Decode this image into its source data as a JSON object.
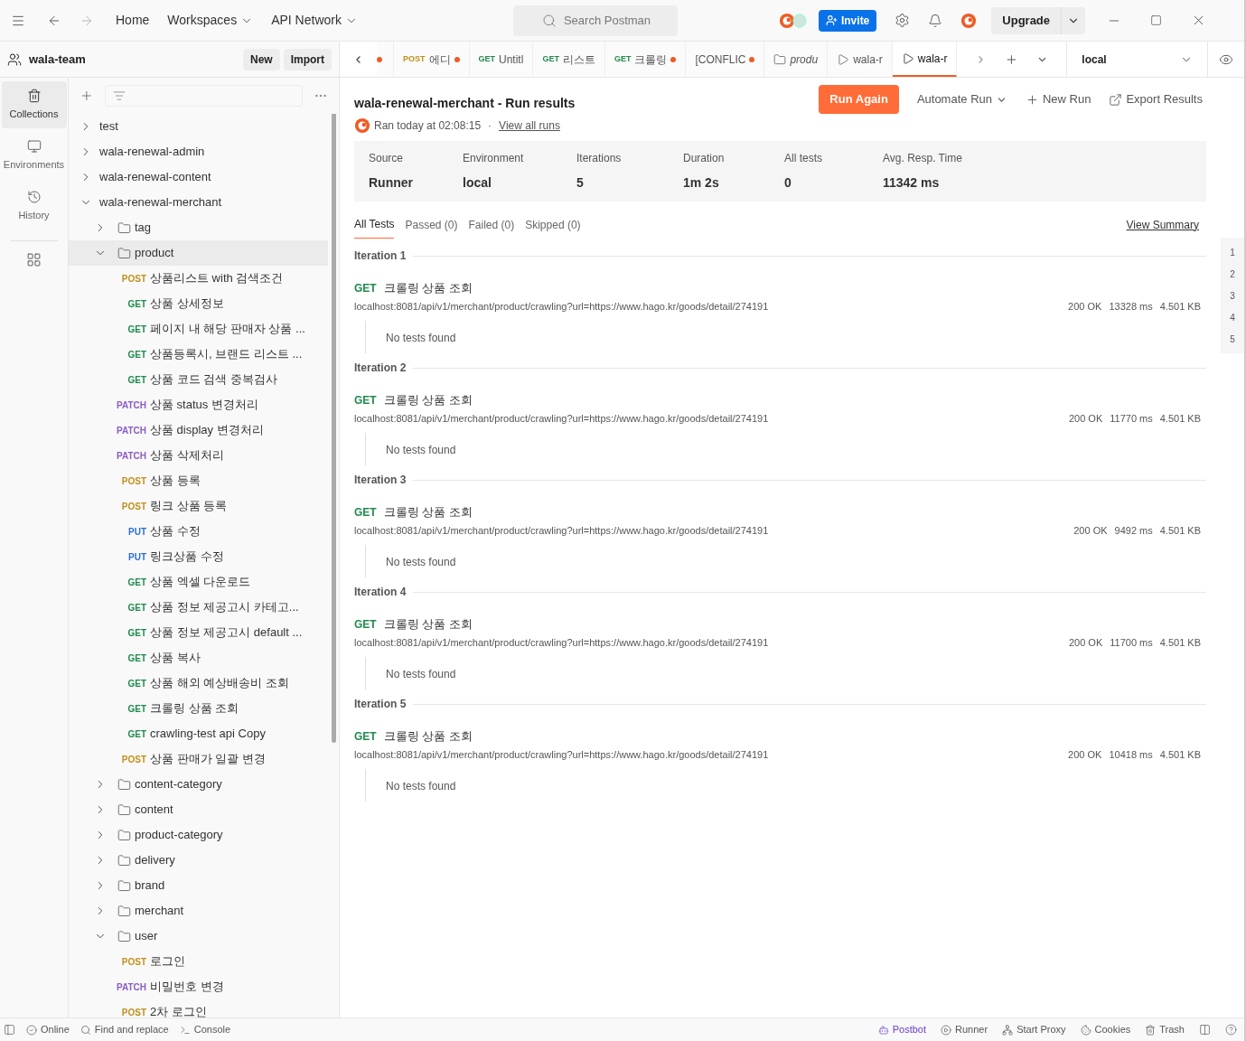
{
  "topbar": {
    "nav": [
      "Home",
      "Workspaces",
      "API Network"
    ],
    "search": {
      "placeholder": "Search Postman"
    },
    "invite": "Invite",
    "upgrade": "Upgrade"
  },
  "workspace": {
    "name": "wala-team",
    "buttons": [
      "New",
      "Import"
    ]
  },
  "rail": [
    {
      "label": "Collections",
      "selected": true
    },
    {
      "label": "Environments",
      "selected": false
    },
    {
      "label": "History",
      "selected": false
    }
  ],
  "tree": [
    {
      "label": "test",
      "expanded": false
    },
    {
      "label": "wala-renewal-admin",
      "expanded": false
    },
    {
      "label": "wala-renewal-content",
      "expanded": false
    },
    {
      "label": "wala-renewal-merchant",
      "expanded": true,
      "children": [
        {
          "label": "tag",
          "kind": "folder",
          "expanded": false,
          "selected": false
        },
        {
          "label": "product",
          "kind": "folder",
          "expanded": true,
          "selected": true,
          "children": [
            {
              "method": "POST",
              "color": "#c0901a",
              "label": "상품리스트 with 검색조건"
            },
            {
              "method": "GET",
              "color": "#1f8a4c",
              "label": "상품 상세정보"
            },
            {
              "method": "GET",
              "color": "#1f8a4c",
              "label": "페이지 내 해당 판매자 상품 ..."
            },
            {
              "method": "GET",
              "color": "#1f8a4c",
              "label": "상품등록시, 브랜드 리스트 ..."
            },
            {
              "method": "GET",
              "color": "#1f8a4c",
              "label": "상품 코드 검색 중복검사"
            },
            {
              "method": "PATCH",
              "color": "#8a5cc4",
              "label": "상품 status 변경처리"
            },
            {
              "method": "PATCH",
              "color": "#8a5cc4",
              "label": "상품 display 변경처리"
            },
            {
              "method": "PATCH",
              "color": "#8a5cc4",
              "label": "상품 삭제처리"
            },
            {
              "method": "POST",
              "color": "#c0901a",
              "label": "상품 등록"
            },
            {
              "method": "POST",
              "color": "#c0901a",
              "label": "링크 상품 등록"
            },
            {
              "method": "PUT",
              "color": "#2b6fd6",
              "label": "상품 수정"
            },
            {
              "method": "PUT",
              "color": "#2b6fd6",
              "label": "링크상품 수정"
            },
            {
              "method": "GET",
              "color": "#1f8a4c",
              "label": "상품 엑셀 다운로드"
            },
            {
              "method": "GET",
              "color": "#1f8a4c",
              "label": "상품 정보 제공고시 카테고..."
            },
            {
              "method": "GET",
              "color": "#1f8a4c",
              "label": "상품 정보 제공고시 default ..."
            },
            {
              "method": "GET",
              "color": "#1f8a4c",
              "label": "상품 복사"
            },
            {
              "method": "GET",
              "color": "#1f8a4c",
              "label": "상품 해외 예상배송비 조회"
            },
            {
              "method": "GET",
              "color": "#1f8a4c",
              "label": "크롤링 상품 조회"
            },
            {
              "method": "GET",
              "color": "#1f8a4c",
              "label": "crawling-test api Copy"
            },
            {
              "method": "POST",
              "color": "#c0901a",
              "label": "상품 판매가 일괄 변경"
            }
          ]
        },
        {
          "label": "content-category",
          "kind": "folder",
          "expanded": false,
          "selected": false
        },
        {
          "label": "content",
          "kind": "folder",
          "expanded": false,
          "selected": false
        },
        {
          "label": "product-category",
          "kind": "folder",
          "expanded": false,
          "selected": false
        },
        {
          "label": "delivery",
          "kind": "folder",
          "expanded": false,
          "selected": false
        },
        {
          "label": "brand",
          "kind": "folder",
          "expanded": false,
          "selected": false
        },
        {
          "label": "merchant",
          "kind": "folder",
          "expanded": false,
          "selected": false
        },
        {
          "label": "user",
          "kind": "folder",
          "expanded": true,
          "selected": false,
          "children": [
            {
              "method": "POST",
              "color": "#c0901a",
              "label": "로그인"
            },
            {
              "method": "PATCH",
              "color": "#8a5cc4",
              "label": "비밀번호 변경"
            },
            {
              "method": "POST",
              "color": "#c0901a",
              "label": "2차 로그인"
            }
          ]
        }
      ]
    }
  ],
  "tabs": [
    {
      "kind": "dot",
      "unsaved": true,
      "selected": false
    },
    {
      "kind": "request",
      "method": "POST",
      "color": "#c0901a",
      "label": "에디",
      "unsaved": true,
      "selected": false
    },
    {
      "kind": "request",
      "method": "GET",
      "color": "#1f8a4c",
      "label": "Untitl",
      "unsaved": false,
      "selected": false
    },
    {
      "kind": "request",
      "method": "GET",
      "color": "#1f8a4c",
      "label": "리스트",
      "unsaved": false,
      "selected": false
    },
    {
      "kind": "request",
      "method": "GET",
      "color": "#1f8a4c",
      "label": "크롤링",
      "unsaved": true,
      "selected": false
    },
    {
      "kind": "plain",
      "label": "[CONFLIC",
      "unsaved": true,
      "selected": false
    },
    {
      "kind": "folder",
      "label": "produ",
      "unsaved": false,
      "selected": false
    },
    {
      "kind": "runner",
      "label": "wala-r",
      "unsaved": false,
      "selected": false
    },
    {
      "kind": "runner",
      "label": "wala-r",
      "unsaved": false,
      "selected": true
    }
  ],
  "environment": "local",
  "run": {
    "title": "wala-renewal-merchant - Run results",
    "ran": "Ran today at 02:08:15",
    "sep": "·",
    "view_all": "View all runs",
    "run_again": "Run Again",
    "automate": "Automate Run",
    "new_run": "New Run",
    "export": "Export Results",
    "stats": [
      {
        "label": "Source",
        "value": "Runner"
      },
      {
        "label": "Environment",
        "value": "local"
      },
      {
        "label": "Iterations",
        "value": "5"
      },
      {
        "label": "Duration",
        "value": "1m 2s"
      },
      {
        "label": "All tests",
        "value": "0"
      },
      {
        "label": "Avg. Resp. Time",
        "value": "11342 ms"
      }
    ],
    "filters": [
      {
        "label": "All Tests",
        "selected": true
      },
      {
        "label": "Passed (0)",
        "selected": false
      },
      {
        "label": "Failed (0)",
        "selected": false
      },
      {
        "label": "Skipped (0)",
        "selected": false
      }
    ],
    "view_summary": "View Summary",
    "iterations": [
      {
        "title": "Iteration 1",
        "marker": "1",
        "method": "GET",
        "name": "크롤링 상품 조회",
        "url": "localhost:8081/api/v1/merchant/product/crawling?url=https://www.hago.kr/goods/detail/274191",
        "status": "200 OK",
        "time": "13328 ms",
        "size": "4.501 KB",
        "tests": "No tests found"
      },
      {
        "title": "Iteration 2",
        "marker": "2",
        "method": "GET",
        "name": "크롤링 상품 조회",
        "url": "localhost:8081/api/v1/merchant/product/crawling?url=https://www.hago.kr/goods/detail/274191",
        "status": "200 OK",
        "time": "11770 ms",
        "size": "4.501 KB",
        "tests": "No tests found"
      },
      {
        "title": "Iteration 3",
        "marker": "3",
        "method": "GET",
        "name": "크롤링 상품 조회",
        "url": "localhost:8081/api/v1/merchant/product/crawling?url=https://www.hago.kr/goods/detail/274191",
        "status": "200 OK",
        "time": "9492 ms",
        "size": "4.501 KB",
        "tests": "No tests found"
      },
      {
        "title": "Iteration 4",
        "marker": "4",
        "method": "GET",
        "name": "크롤링 상품 조회",
        "url": "localhost:8081/api/v1/merchant/product/crawling?url=https://www.hago.kr/goods/detail/274191",
        "status": "200 OK",
        "time": "11700 ms",
        "size": "4.501 KB",
        "tests": "No tests found"
      },
      {
        "title": "Iteration 5",
        "marker": "5",
        "method": "GET",
        "name": "크롤링 상품 조회",
        "url": "localhost:8081/api/v1/merchant/product/crawling?url=https://www.hago.kr/goods/detail/274191",
        "status": "200 OK",
        "time": "10418 ms",
        "size": "4.501 KB",
        "tests": "No tests found"
      }
    ]
  },
  "statusbar": {
    "left": [
      "Online",
      "Find and replace",
      "Console"
    ],
    "right": [
      "Postbot",
      "Runner",
      "Start Proxy",
      "Cookies",
      "Trash"
    ]
  }
}
